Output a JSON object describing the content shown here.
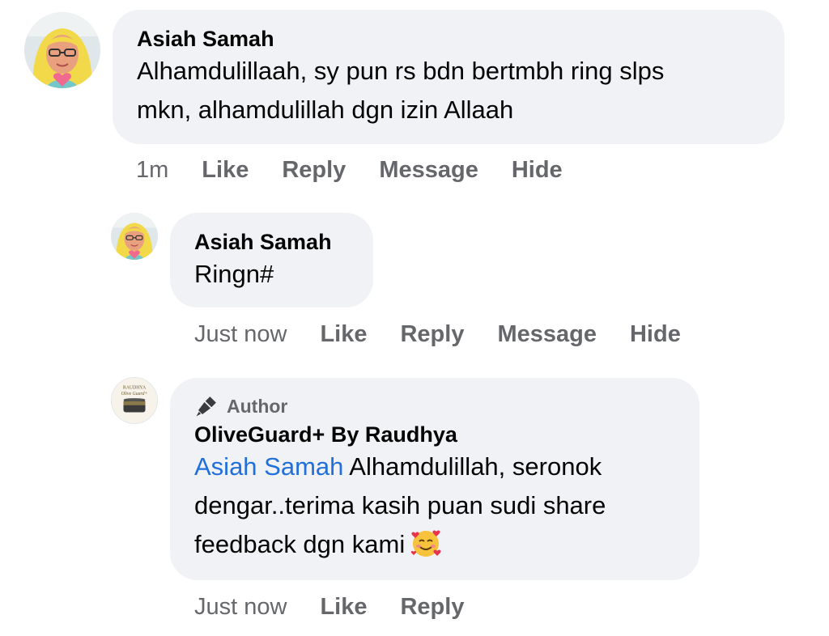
{
  "comments": [
    {
      "author": "Asiah Samah",
      "text_line1": "Alhamdulillaah, sy pun rs bdn bertmbh ring slps",
      "text_line2": "mkn, alhamdulillah dgn izin Allaah",
      "time": "1m",
      "actions": [
        "Like",
        "Reply",
        "Message",
        "Hide"
      ]
    },
    {
      "author": "Asiah Samah",
      "text": "Ringn#",
      "time": "Just now",
      "actions": [
        "Like",
        "Reply",
        "Message",
        "Hide"
      ]
    },
    {
      "badge": "Author",
      "author": "OliveGuard+ By Raudhya",
      "mention": "Asiah Samah",
      "text_line1": "Alhamdulillah, seronok",
      "text_line2": "dengar..terima kasih puan sudi share",
      "text_line3": "feedback dgn kami",
      "emoji": "smiling-face-with-hearts",
      "time": "Just now",
      "actions": [
        "Like",
        "Reply"
      ],
      "avatar_label_1": "RAUDHYA",
      "avatar_label_2": "Olive Guard+"
    }
  ],
  "colors": {
    "bubble": "#f0f2f5",
    "meta_text": "#65676b",
    "mention": "#216fdb"
  }
}
